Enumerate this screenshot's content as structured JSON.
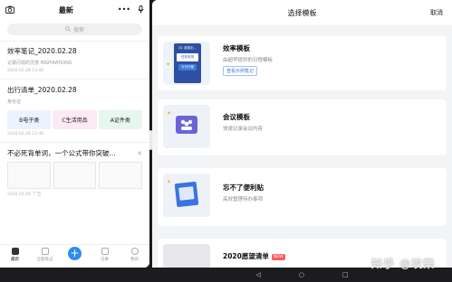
{
  "left": {
    "header": {
      "title": "最新",
      "camera_icon": "camera-icon",
      "more_icon": "more-icon",
      "mic_icon": "mic-icon",
      "more_glyph": "•••"
    },
    "search_placeholder": "搜索",
    "notes": [
      {
        "title": "效率笔记_2020.02.28",
        "subtitle": "记录闪现的灵感  INSPIRATIONS",
        "date": "2020.02.28  13:46"
      },
      {
        "title": "出行清单_2020.02.28",
        "subtitle": "身份证",
        "tags": [
          "B电子类",
          "C生活用品",
          "A证件类"
        ],
        "date": "2020.02.28  13:46"
      },
      {
        "title": "不必死背单词，一个公式带你突破...",
        "cards": [
          "",
          "",
          ""
        ],
        "date": "2020.02.28",
        "ad": "广告"
      }
    ],
    "tabbar": [
      "最新",
      "全部笔记",
      "",
      "记事",
      "我的"
    ]
  },
  "right": {
    "header": {
      "title": "选择模板",
      "cancel": "取消"
    },
    "templates": [
      {
        "name": "效率模板",
        "desc": "由超早提供的日程模板",
        "link": "查看示例笔记",
        "thumb_lines": [
          "Q1 选择出...",
          "任务安排",
          "今日行程"
        ]
      },
      {
        "name": "会议模板",
        "desc": "快速记录会议内容"
      },
      {
        "name": "忘不了便利贴",
        "desc": "高效管理待办事项"
      },
      {
        "name": "2020愿望清单",
        "badge": "NEW"
      }
    ]
  },
  "nav": {
    "back": "◁",
    "home": "○",
    "recent": "□"
  },
  "watermark": "知乎 @坟樂"
}
